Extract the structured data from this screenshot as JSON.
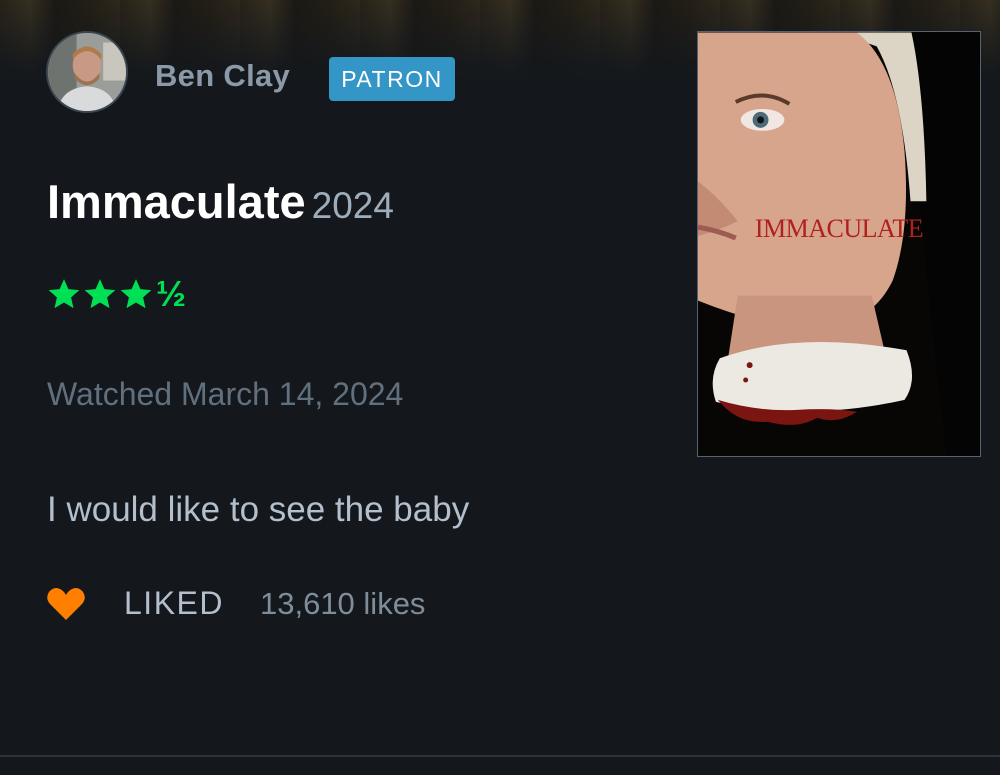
{
  "user": {
    "name": "Ben Clay",
    "badge": "PATRON"
  },
  "film": {
    "title": "Immaculate",
    "year": "2024",
    "poster_title": "IMMACULATE"
  },
  "rating": {
    "stars": 3.5,
    "max": 5,
    "half_glyph": "½"
  },
  "watched": "Watched March 14, 2024",
  "review": "I would like to see the baby",
  "likes": {
    "status": "LIKED",
    "count": "13,610 likes"
  },
  "colors": {
    "background": "#14181c",
    "star": "#00e054",
    "heart": "#ff8000",
    "badge": "#3495c7"
  },
  "icons": [
    "star-icon",
    "heart-icon"
  ]
}
